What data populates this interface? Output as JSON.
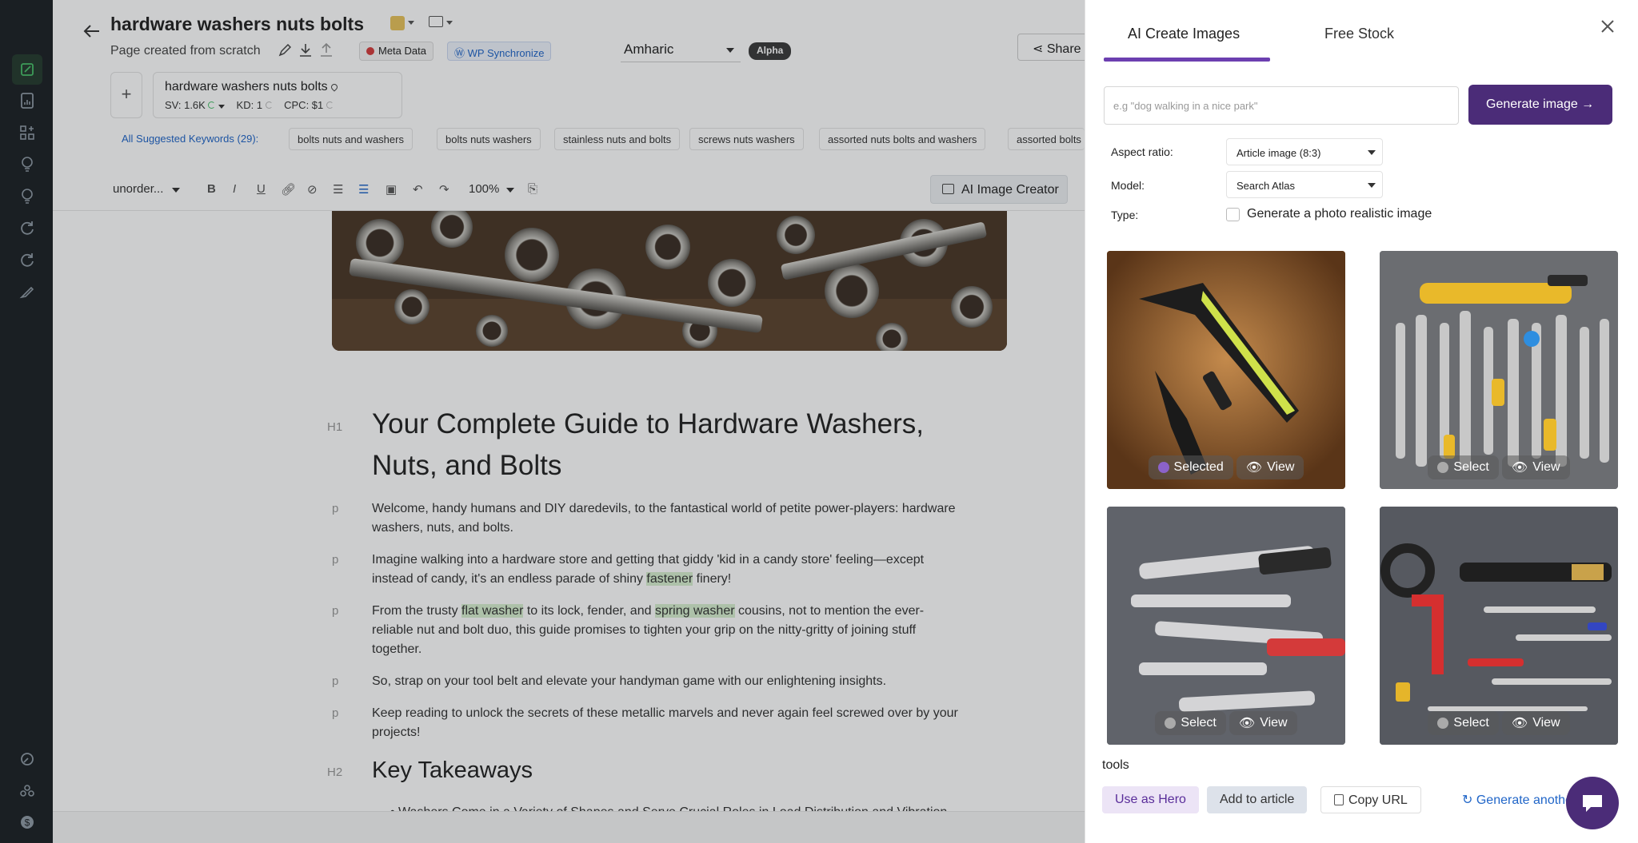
{
  "rail": {
    "icons": [
      "edit-icon",
      "document-icon",
      "widgets-icon",
      "bulb-icon",
      "bulb-outline-icon",
      "refresh-icon",
      "sync-icon",
      "pen-icon",
      "search-settings-icon",
      "users-icon",
      "dollar-icon"
    ]
  },
  "header": {
    "title": "hardware washers nuts bolts",
    "subtitle": "Page created from scratch",
    "meta_label": "Meta Data",
    "wp_label": "WP Synchronize",
    "language": "Amharic",
    "alpha": "Alpha",
    "share": "Share"
  },
  "keyword": {
    "name": "hardware washers nuts bolts",
    "sv": "SV: 1.6K",
    "kd": "KD: 1",
    "cpc": "CPC: $1"
  },
  "suggested": {
    "label": "All Suggested Keywords (29):",
    "items": [
      "bolts nuts and washers",
      "bolts nuts washers",
      "stainless nuts and bolts",
      "screws nuts washers",
      "assorted nuts bolts and washers",
      "assorted bolts"
    ]
  },
  "toolbar": {
    "style": "unorder...",
    "zoom": "100%",
    "ai_creator": "AI Image Creator"
  },
  "article": {
    "h1_tag": "H1",
    "h1": "Your Complete Guide to Hardware Washers, Nuts, and Bolts",
    "p_tag": "p",
    "p1": "Welcome, handy humans and DIY daredevils, to the fantastical world of petite power-players: hardware washers, nuts, and bolts.",
    "p2a": "Imagine walking into a hardware store and getting that giddy 'kid in a candy store' feeling—except instead of candy, it's an endless parade of shiny ",
    "p2b": "fastener",
    "p2c": " finery!",
    "p3a": "From the trusty ",
    "p3b": "flat washer",
    "p3c": " to its lock, fender, and ",
    "p3d": "spring washer",
    "p3e": " cousins, not to mention the ever-reliable nut and bolt duo, this guide promises to tighten your grip on the nitty-gritty of joining stuff together.",
    "p4": "So, strap on your tool belt and elevate your handyman game with our enlightening insights.",
    "p5": "Keep reading to unlock the secrets of these metallic marvels and never again feel screwed over by your projects!",
    "h2_tag": "H2",
    "h2": "Key Takeaways",
    "bullet": "Washers Come in a Variety of Shapes and Serve Crucial Roles in Load Distribution and Vibration"
  },
  "panel": {
    "tab_ai": "AI Create Images",
    "tab_stock": "Free Stock",
    "prompt_placeholder": "e.g \"dog walking in a nice park\"",
    "generate": "Generate image →",
    "aspect_label": "Aspect ratio:",
    "aspect_value": "Article image (8:3)",
    "model_label": "Model:",
    "model_value": "Search Atlas",
    "type_label": "Type:",
    "type_option": "Generate a photo realistic image",
    "tiles": [
      {
        "select": "Selected",
        "view": "View"
      },
      {
        "select": "Select",
        "view": "View"
      },
      {
        "select": "Select",
        "view": "View"
      },
      {
        "select": "Select",
        "view": "View"
      }
    ],
    "caption": "tools",
    "use_hero": "Use as Hero",
    "add_article": "Add to article",
    "copy_url": "Copy URL",
    "generate_another": "Generate another image"
  },
  "colors": {
    "accent": "#4b2c78",
    "tab_underline": "#6c3fb0",
    "link": "#2166c8",
    "highlight": "#d8f0d0"
  }
}
